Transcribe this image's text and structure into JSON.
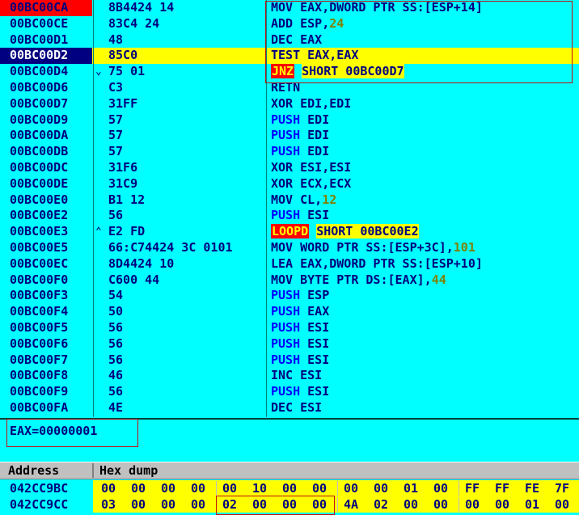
{
  "disassembly": [
    {
      "address": "00BC00CA",
      "hex": "8B4424 14",
      "asm": [
        {
          "t": "MOV EAX,DWORD PTR SS:[ESP+14]"
        }
      ],
      "state": "cur"
    },
    {
      "address": "00BC00CE",
      "hex": "83C4 24",
      "asm": [
        {
          "t": "ADD ESP,"
        },
        {
          "t": "24",
          "c": "imm"
        }
      ]
    },
    {
      "address": "00BC00D1",
      "hex": "48",
      "asm": [
        {
          "t": "DEC EAX"
        }
      ]
    },
    {
      "address": "00BC00D2",
      "hex": "85C0",
      "asm": [
        {
          "t": "TEST EAX,EAX"
        }
      ],
      "state": "sel",
      "highlight": true
    },
    {
      "address": "00BC00D4",
      "mark": "⌄",
      "hex": "75 01",
      "asm": [
        {
          "t": "JNZ",
          "c": "kw-jmp"
        },
        {
          "t": " "
        },
        {
          "t": "SHORT 00BC00D7",
          "c": "hlbg"
        }
      ]
    },
    {
      "address": "00BC00D6",
      "hex": "C3",
      "asm": [
        {
          "t": "RETN"
        }
      ]
    },
    {
      "address": "00BC00D7",
      "hex": "31FF",
      "asm": [
        {
          "t": "XOR EDI,EDI"
        }
      ]
    },
    {
      "address": "00BC00D9",
      "hex": "57",
      "asm": [
        {
          "t": "PUSH",
          "c": "kw-push"
        },
        {
          "t": " EDI"
        }
      ]
    },
    {
      "address": "00BC00DA",
      "hex": "57",
      "asm": [
        {
          "t": "PUSH",
          "c": "kw-push"
        },
        {
          "t": " EDI"
        }
      ]
    },
    {
      "address": "00BC00DB",
      "hex": "57",
      "asm": [
        {
          "t": "PUSH",
          "c": "kw-push"
        },
        {
          "t": " EDI"
        }
      ]
    },
    {
      "address": "00BC00DC",
      "hex": "31F6",
      "asm": [
        {
          "t": "XOR ESI,ESI"
        }
      ]
    },
    {
      "address": "00BC00DE",
      "hex": "31C9",
      "asm": [
        {
          "t": "XOR ECX,ECX"
        }
      ]
    },
    {
      "address": "00BC00E0",
      "hex": "B1 12",
      "asm": [
        {
          "t": "MOV CL,"
        },
        {
          "t": "12",
          "c": "imm"
        }
      ]
    },
    {
      "address": "00BC00E2",
      "hex": "56",
      "asm": [
        {
          "t": "PUSH",
          "c": "kw-push"
        },
        {
          "t": " ESI"
        }
      ]
    },
    {
      "address": "00BC00E3",
      "mark": "⌃",
      "hex": "E2 FD",
      "asm": [
        {
          "t": "LOOPD",
          "c": "kw-jmp"
        },
        {
          "t": " "
        },
        {
          "t": "SHORT 00BC00E2",
          "c": "hlbg"
        }
      ]
    },
    {
      "address": "00BC00E5",
      "hex": "66:C74424 3C 0101",
      "asm": [
        {
          "t": "MOV WORD PTR SS:[ESP+3C],"
        },
        {
          "t": "101",
          "c": "imm"
        }
      ]
    },
    {
      "address": "00BC00EC",
      "hex": "8D4424 10",
      "asm": [
        {
          "t": "LEA EAX,DWORD PTR SS:[ESP+10]"
        }
      ]
    },
    {
      "address": "00BC00F0",
      "hex": "C600 44",
      "asm": [
        {
          "t": "MOV BYTE PTR DS:[EAX],"
        },
        {
          "t": "44",
          "c": "imm"
        }
      ]
    },
    {
      "address": "00BC00F3",
      "hex": "54",
      "asm": [
        {
          "t": "PUSH",
          "c": "kw-push"
        },
        {
          "t": " ESP"
        }
      ]
    },
    {
      "address": "00BC00F4",
      "hex": "50",
      "asm": [
        {
          "t": "PUSH",
          "c": "kw-push"
        },
        {
          "t": " EAX"
        }
      ]
    },
    {
      "address": "00BC00F5",
      "hex": "56",
      "asm": [
        {
          "t": "PUSH",
          "c": "kw-push"
        },
        {
          "t": " ESI"
        }
      ]
    },
    {
      "address": "00BC00F6",
      "hex": "56",
      "asm": [
        {
          "t": "PUSH",
          "c": "kw-push"
        },
        {
          "t": " ESI"
        }
      ]
    },
    {
      "address": "00BC00F7",
      "hex": "56",
      "asm": [
        {
          "t": "PUSH",
          "c": "kw-push"
        },
        {
          "t": " ESI"
        }
      ]
    },
    {
      "address": "00BC00F8",
      "hex": "46",
      "asm": [
        {
          "t": "INC ESI"
        }
      ]
    },
    {
      "address": "00BC00F9",
      "hex": "56",
      "asm": [
        {
          "t": "PUSH",
          "c": "kw-push"
        },
        {
          "t": " ESI"
        }
      ]
    },
    {
      "address": "00BC00FA",
      "hex": "4E",
      "asm": [
        {
          "t": "DEC ESI"
        }
      ]
    }
  ],
  "info_pane": {
    "text": "EAX=00000001"
  },
  "dump": {
    "col_address": "Address",
    "col_hexdump": "Hex dump",
    "rows": [
      {
        "address": "042CC9BC",
        "bytes": [
          "00",
          "00",
          "00",
          "00",
          "00",
          "10",
          "00",
          "00",
          "00",
          "00",
          "01",
          "00",
          "FF",
          "FF",
          "FE",
          "7F"
        ]
      },
      {
        "address": "042CC9CC",
        "bytes": [
          "03",
          "00",
          "00",
          "00",
          "02",
          "00",
          "00",
          "00",
          "4A",
          "02",
          "00",
          "00",
          "00",
          "00",
          "01",
          "00"
        ]
      }
    ]
  },
  "colors": {
    "pane_bg": "#00ffff",
    "text": "#000080",
    "highlight": "#ffff00",
    "annotation": "#c01010"
  }
}
